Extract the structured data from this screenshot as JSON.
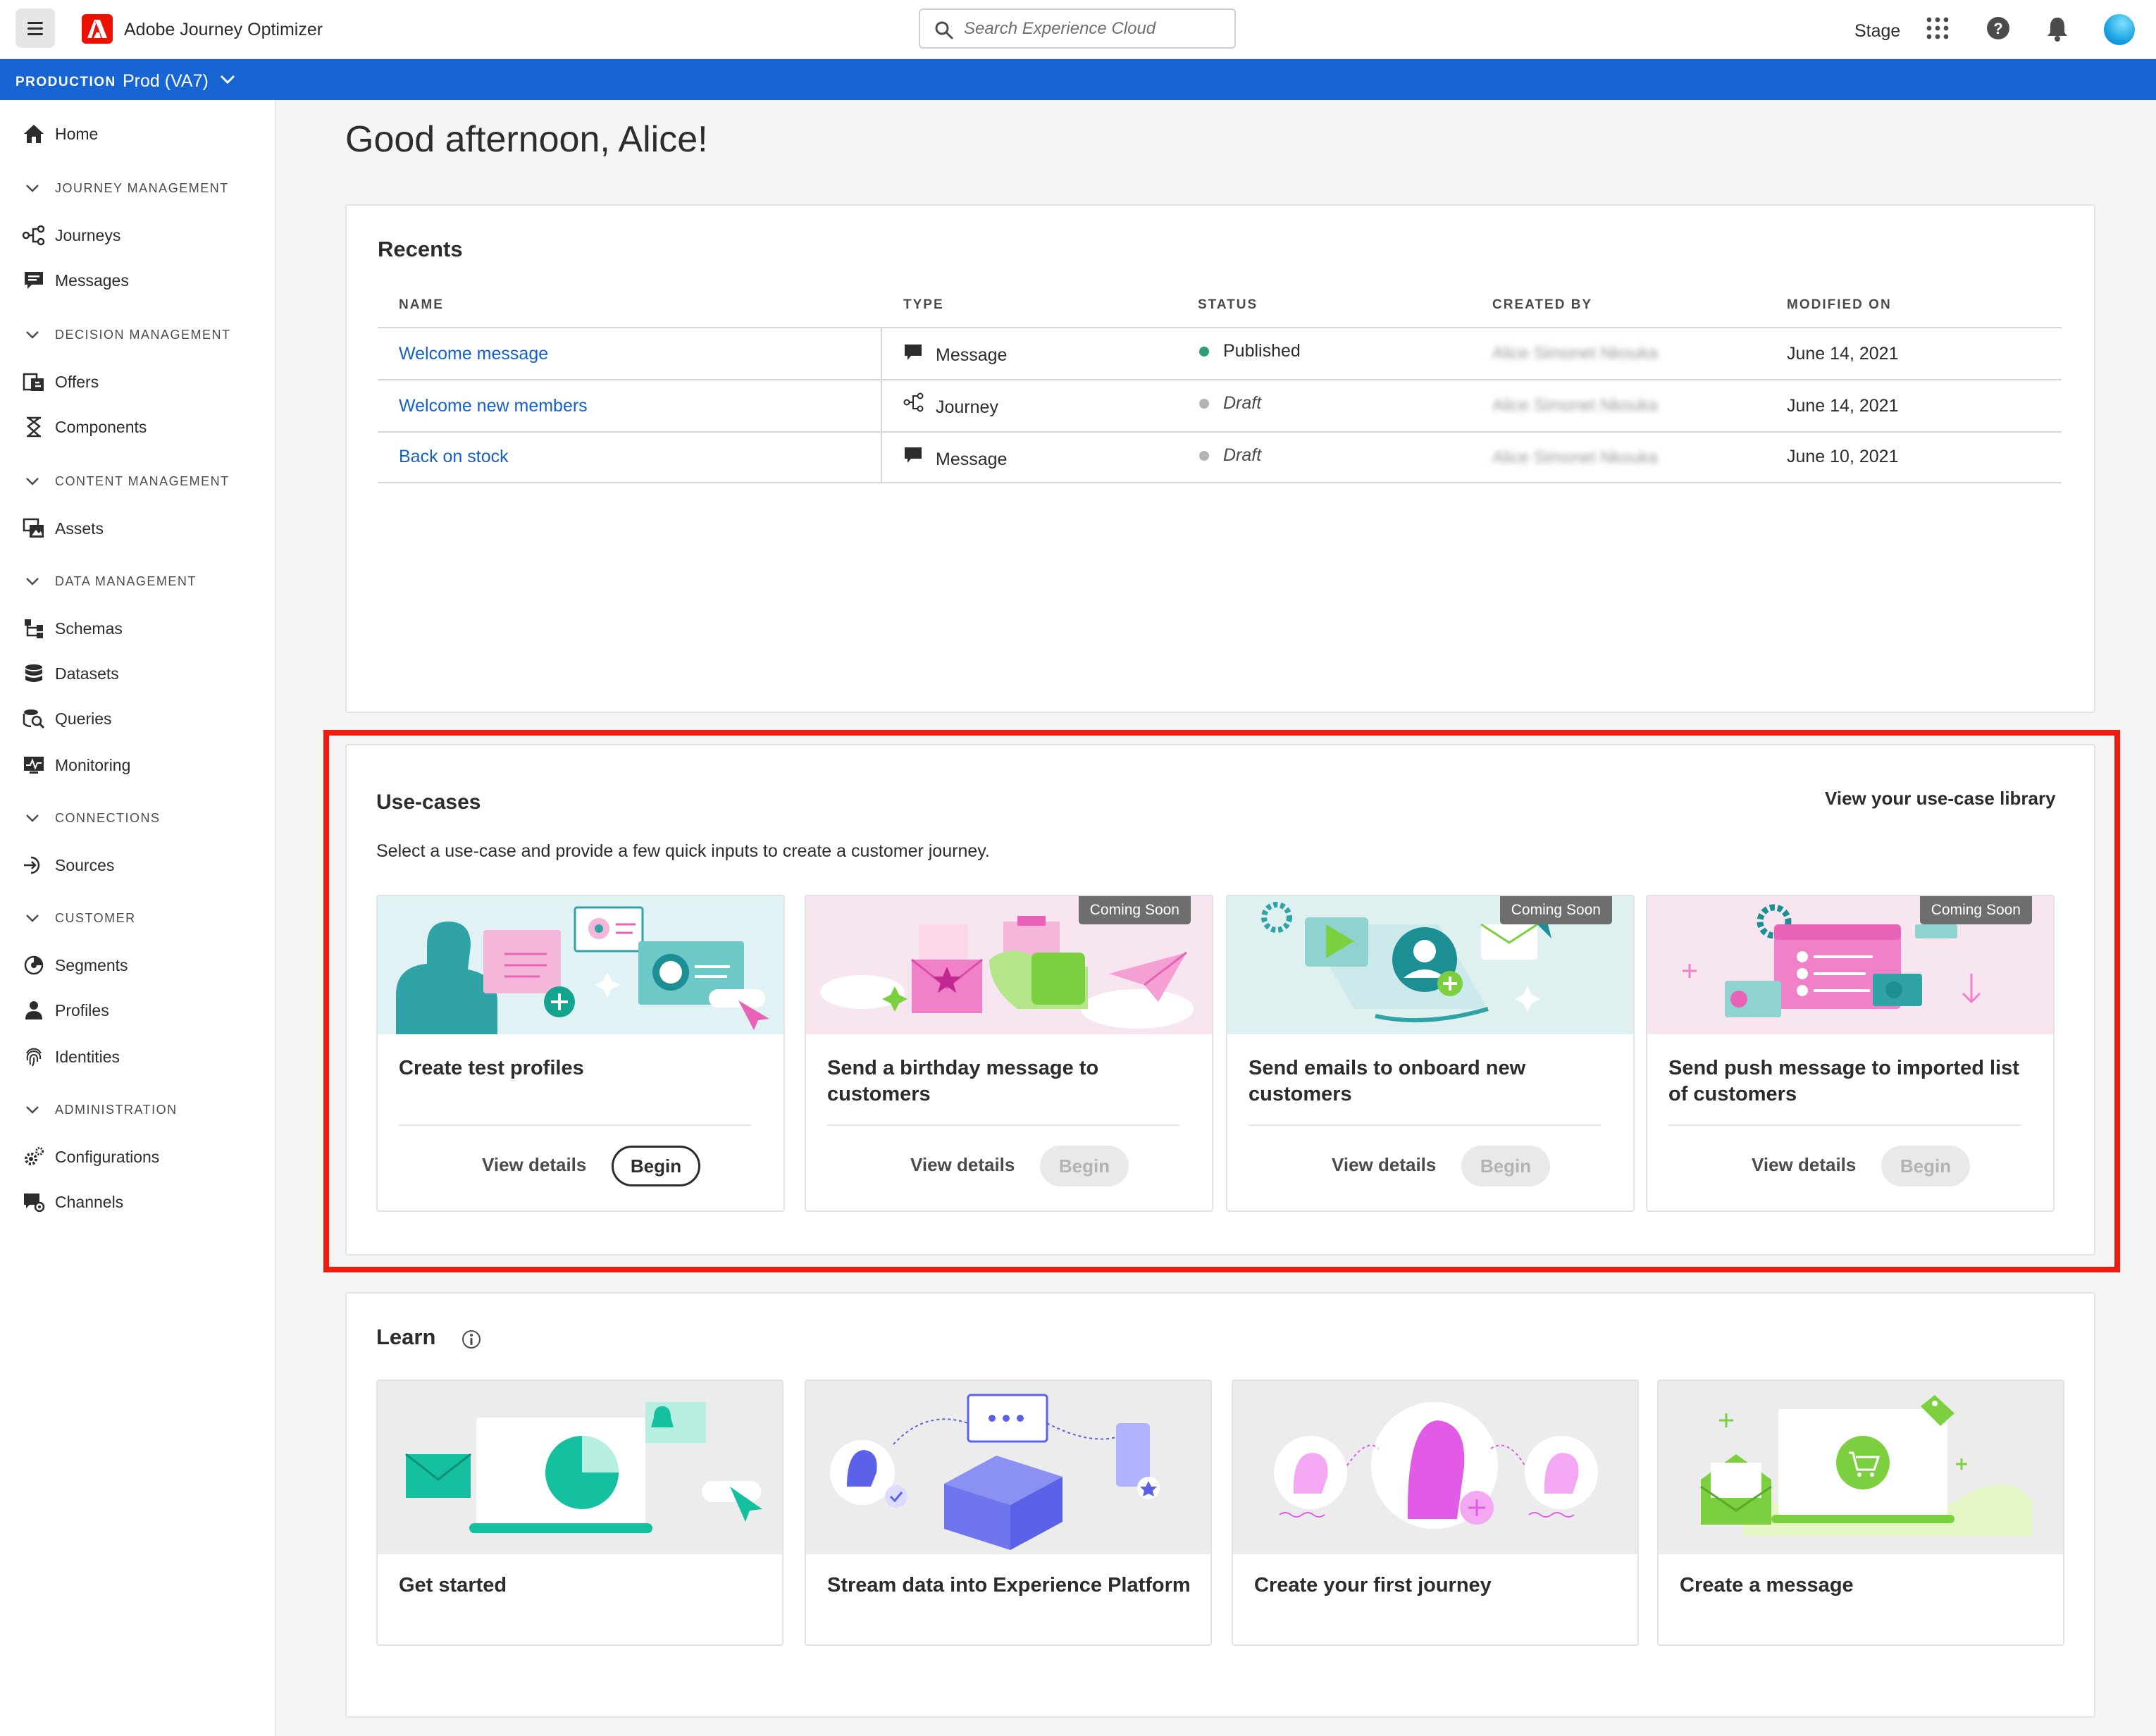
{
  "header": {
    "app_title": "Adobe Journey Optimizer",
    "search_placeholder": "Search Experience Cloud",
    "stage_label": "Stage"
  },
  "orgbar": {
    "env_label": "PRODUCTION",
    "org_name": "Prod (VA7)"
  },
  "sidebar": {
    "home": "Home",
    "sections": {
      "journey": "JOURNEY MANAGEMENT",
      "decision": "DECISION MANAGEMENT",
      "content": "CONTENT MANAGEMENT",
      "data": "DATA MANAGEMENT",
      "connections": "CONNECTIONS",
      "customer": "CUSTOMER",
      "administration": "ADMINISTRATION"
    },
    "items": {
      "journeys": "Journeys",
      "messages": "Messages",
      "offers": "Offers",
      "components": "Components",
      "assets": "Assets",
      "schemas": "Schemas",
      "datasets": "Datasets",
      "queries": "Queries",
      "monitoring": "Monitoring",
      "sources": "Sources",
      "segments": "Segments",
      "profiles": "Profiles",
      "identities": "Identities",
      "configurations": "Configurations",
      "channels": "Channels"
    }
  },
  "greeting": "Good afternoon, Alice!",
  "recents": {
    "title": "Recents",
    "columns": [
      "NAME",
      "TYPE",
      "STATUS",
      "CREATED BY",
      "MODIFIED ON"
    ],
    "rows": [
      {
        "name": "Welcome message",
        "type": "Message",
        "type_icon": "message-icon",
        "status": "Published",
        "status_color": "#2d9d78",
        "created_by": "Alice Simonet Nkouka",
        "modified_on": "June 14, 2021"
      },
      {
        "name": "Welcome new members",
        "type": "Journey",
        "type_icon": "journey-icon",
        "status": "Draft",
        "status_color": "#b3b3b3",
        "created_by": "Alice Simonet Nkouka",
        "modified_on": "June 14, 2021"
      },
      {
        "name": "Back on stock",
        "type": "Message",
        "type_icon": "message-icon",
        "status": "Draft",
        "status_color": "#b3b3b3",
        "created_by": "Alice Simonet Nkouka",
        "modified_on": "June 10, 2021"
      }
    ]
  },
  "usecases": {
    "title": "Use-cases",
    "library_link": "View your use-case library",
    "description": "Select a use-case and provide a few quick inputs to create a customer journey.",
    "view_details_label": "View details",
    "begin_label": "Begin",
    "coming_soon_label": "Coming Soon",
    "tiles": [
      {
        "title": "Create test profiles",
        "enabled": true
      },
      {
        "title": "Send a birthday message to customers",
        "enabled": false
      },
      {
        "title": "Send emails to onboard new customers",
        "enabled": false
      },
      {
        "title": "Send push message to imported list of customers",
        "enabled": false
      }
    ]
  },
  "learn": {
    "title": "Learn",
    "tiles": [
      {
        "title": "Get started"
      },
      {
        "title": "Stream data into Experience Platform"
      },
      {
        "title": "Create your first journey"
      },
      {
        "title": "Create a message"
      }
    ]
  },
  "colors": {
    "accent": "#1765d2",
    "link": "#1460c8",
    "highlight": "#ee1b0f",
    "brand": "#eb1000"
  }
}
